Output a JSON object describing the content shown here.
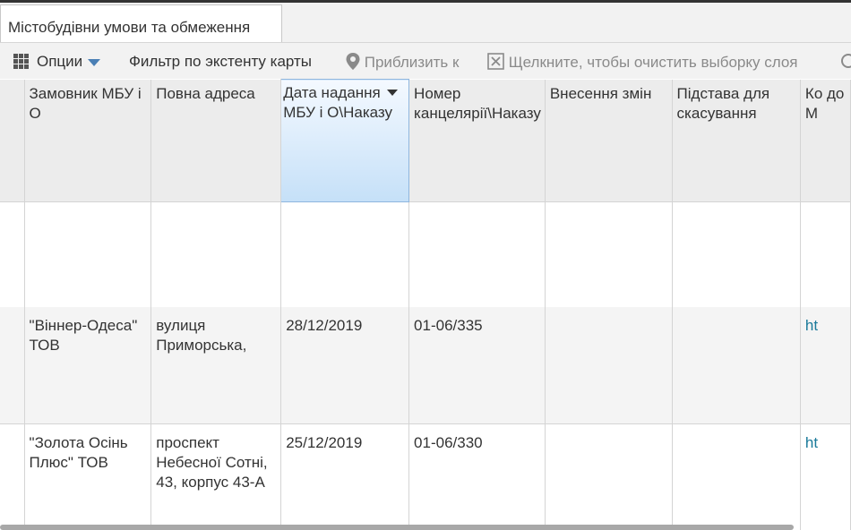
{
  "tab": {
    "label": "Містобудівни умови та обмеження"
  },
  "toolbar": {
    "options_label": "Опции",
    "filter_label": "Фильтр по экстенту карты",
    "zoom_label": "Приблизить к",
    "clear_label": "Щелкните, чтобы очистить выборку слоя"
  },
  "columns": [
    "Замовник МБУ і О",
    "Повна адреса",
    "Дата надання МБУ і О\\Наказу",
    "Номер канцелярії\\Наказу",
    "Внесення змін",
    "Підстава для скасування",
    "Ко до М"
  ],
  "rows": [
    {
      "customer": "",
      "address": "",
      "date": "",
      "number": "",
      "changes": "",
      "reason": "",
      "link": ""
    },
    {
      "customer": "\"Віннер-Одеса\" ТОВ",
      "address": "вулиця Приморська,",
      "date": "28/12/2019",
      "number": "01-06/335",
      "changes": "",
      "reason": "",
      "link": "ht"
    },
    {
      "customer": "\"Золота Осінь Плюс\" ТОВ",
      "address": "проспект Небесної Сотні, 43, корпус 43-А",
      "date": "25/12/2019",
      "number": "01-06/330",
      "changes": "",
      "reason": "",
      "link": "ht"
    }
  ],
  "colors": {
    "sorted_header": "#c5e0f8",
    "link": "#1a7a9a",
    "menu_arrow": "#4a7fb5"
  }
}
